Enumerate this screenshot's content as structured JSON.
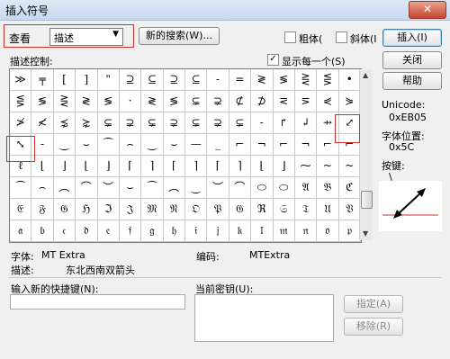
{
  "window": {
    "title": "插入符号",
    "close_glyph": "✕"
  },
  "view": {
    "label": "查看",
    "select_value": "描述",
    "select_arrow": "▼"
  },
  "buttons": {
    "new_search": "新的搜索(W)...",
    "insert": "插入(I)",
    "close": "关闭",
    "help": "帮助",
    "assign": "指定(A)",
    "remove": "移除(R)"
  },
  "checkboxes": {
    "bold": "粗体(",
    "italic": "斜体(I"
  },
  "description_control": {
    "label": "描述控制:",
    "show_each_label": "显示每一个(S)",
    "show_each_checked": "✓"
  },
  "symbols": [
    [
      "≫",
      "╤",
      "[",
      "]",
      "\"",
      "⊇",
      "⊆",
      "⊇",
      "⊆",
      "-",
      "=",
      "≷",
      "≶",
      "⋛",
      "⋚",
      "•"
    ],
    [
      "⋚",
      "≶",
      "⋛",
      "≷",
      "≶",
      "·",
      "≷",
      "≶",
      "⊊",
      "⊋",
      "⊄",
      "⊅",
      "⋜",
      "⋝",
      "⋞",
      "⋟"
    ],
    [
      "≯",
      "≮",
      "⋨",
      "⋩",
      "⊊",
      "⊋",
      "⊊",
      "⊋",
      "⊊",
      "⊋",
      "⊊",
      "-",
      "↱",
      "↲",
      "⇸",
      "⤢"
    ],
    [
      "⤡",
      "-",
      "‿",
      "⌣",
      "⁀",
      "⌢",
      "‿",
      "⌣",
      "—",
      "_",
      "⌐",
      "¬",
      "⌐",
      "¬",
      "⌐",
      "⌐"
    ],
    [
      "ℓ",
      "⌊",
      "⌋",
      "⌊",
      "⌋",
      "⌈",
      "⌉",
      "⌈",
      "⌉",
      "⌈",
      "⌉",
      "⌊",
      "⌋",
      "⁓",
      "~",
      "~"
    ],
    [
      "⁀",
      "⌢",
      "︵",
      "⌒",
      "︶",
      "⌣",
      "⁀",
      "︵",
      "‿",
      "︶",
      "⌒",
      "⬭",
      "⬭",
      "𝔄",
      "𝔅",
      "ℭ"
    ],
    [
      "𝔈",
      "𝔉",
      "𝔊",
      "ℌ",
      "ℑ",
      "𝔍",
      "𝔐",
      "𝔑",
      "𝔒",
      "𝔓",
      "𝔊",
      "ℜ",
      "𝔖",
      "𝔗",
      "𝔘",
      "𝔙"
    ],
    [
      "𝔞",
      "𝔟",
      "𝔠",
      "𝔡",
      "𝔢",
      "𝔣",
      "𝔤",
      "𝔥",
      "𝔦",
      "𝔧",
      "𝔨",
      "𝔩",
      "𝔪",
      "𝔫",
      "𝔬",
      "𝔭"
    ]
  ],
  "codes": {
    "unicode_label": "Unicode:",
    "unicode_value": "0xEB05",
    "charpos_label": "字体位置:",
    "charpos_value": "0x5C",
    "key_label": "按键:",
    "key_value": "\\"
  },
  "info": {
    "font_label": "字体:",
    "font_value": "MT Extra",
    "code_label": "编码:",
    "code_value": "MTExtra",
    "desc_label": "描述:",
    "desc_value": "东北西南双箭头"
  },
  "shortcut": {
    "new_label": "输入新的快捷键(N):",
    "current_label": "当前密钥(U):",
    "new_value": ""
  },
  "colors": {
    "highlight": "#d0312d",
    "preview_arrow": "#000000",
    "preview_marker": "#d0312d"
  }
}
